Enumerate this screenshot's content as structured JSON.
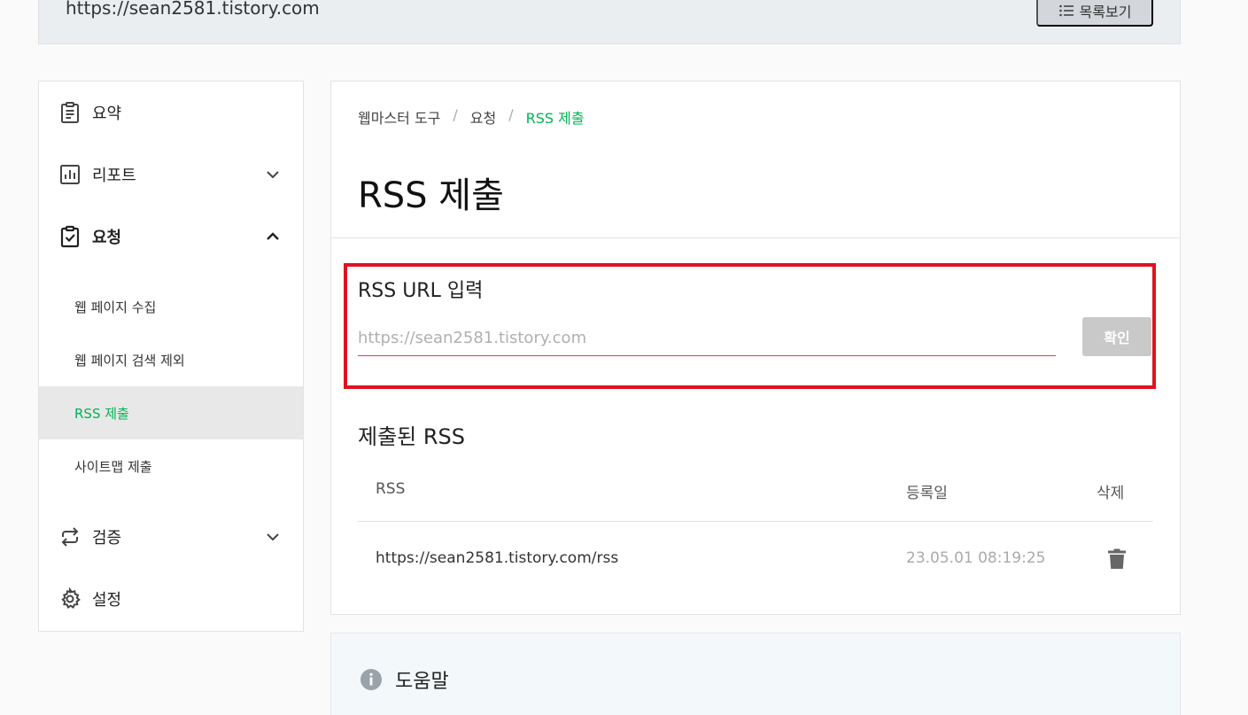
{
  "header": {
    "site_url": "https://sean2581.tistory.com",
    "list_button_label": "목록보기"
  },
  "sidebar": {
    "items": [
      {
        "label": "요약",
        "icon": "clipboard-icon"
      },
      {
        "label": "리포트",
        "icon": "bar-chart-icon"
      },
      {
        "label": "요청",
        "icon": "clipboard-check-icon"
      },
      {
        "label": "검증",
        "icon": "repeat-icon"
      },
      {
        "label": "설정",
        "icon": "gear-icon"
      }
    ],
    "sub_items": [
      {
        "label": "웹 페이지 수집"
      },
      {
        "label": "웹 페이지 검색 제외"
      },
      {
        "label": "RSS 제출"
      },
      {
        "label": "사이트맵 제출"
      }
    ]
  },
  "main": {
    "breadcrumb": [
      "웹마스터 도구",
      "요청",
      "RSS 제출"
    ],
    "breadcrumb_sep": "/",
    "title": "RSS 제출",
    "input": {
      "label": "RSS URL 입력",
      "placeholder": "https://sean2581.tistory.com",
      "value": ""
    },
    "confirm_label": "확인",
    "submitted_title": "제출된 RSS",
    "table": {
      "headers": [
        "RSS",
        "등록일",
        "삭제"
      ],
      "rows": [
        {
          "rss": "https://sean2581.tistory.com/rss",
          "date": "23.05.01 08:19:25"
        }
      ]
    }
  },
  "help": {
    "title": "도움말"
  },
  "colors": {
    "accent_green": "#00b454",
    "highlight_red": "#e0121f"
  }
}
